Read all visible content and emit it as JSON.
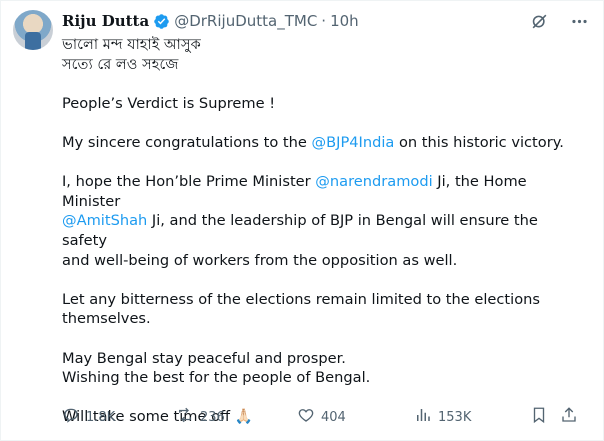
{
  "author": {
    "name": "Riju Dutta",
    "handle": "@DrRijuDutta_TMC",
    "separator": "·",
    "time": "10h"
  },
  "post": {
    "line1": "ভালো মন্দ যাহাই আসুক",
    "line2": "সত্যে রে লও সহজে",
    "verdict": "People’s Verdict is Supreme !",
    "congrats_pre": "My sincere congratulations to the ",
    "congrats_mention": "@BJP4India",
    "congrats_post": " on this historic victory.",
    "p3_a": "I, hope the Hon’ble Prime Minister ",
    "p3_mention1": "@narendramodi",
    "p3_b": " Ji, the Home Minister",
    "p3_mention2": "@AmitShah",
    "p3_c": " Ji, and the leadership of BJP in Bengal will ensure the safety",
    "p3_d": "and well-being of workers from the opposition as well.",
    "p4_a": "Let any bitterness of the elections remain limited to the elections",
    "p4_b": "themselves.",
    "p5_a": "May Bengal stay peaceful and prosper.",
    "p5_b": "Wishing the best for the people of Bengal.",
    "p6": "Will take some time off",
    "emoji": "🙏🏻"
  },
  "actions": {
    "replies": "1.8K",
    "reposts": "236",
    "likes": "404",
    "views": "153K"
  },
  "colors": {
    "accent": "#1d9bf0",
    "muted": "#536471",
    "text": "#0f1419"
  },
  "icons": [
    "verified-badge-icon",
    "grok-icon",
    "more-icon",
    "reply-icon",
    "repost-icon",
    "like-icon",
    "views-icon",
    "bookmark-icon",
    "share-icon"
  ]
}
